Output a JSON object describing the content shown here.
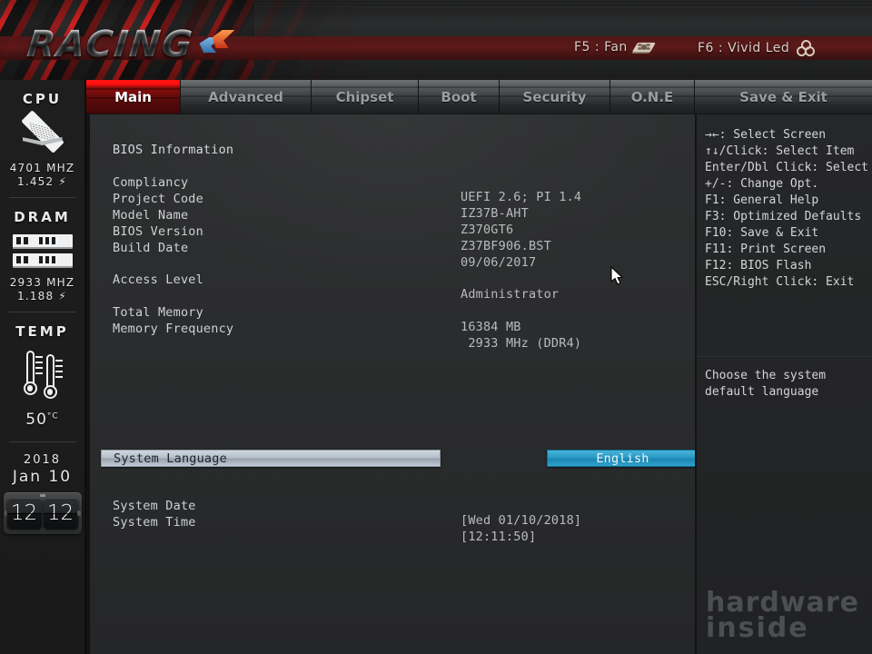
{
  "brand": {
    "logo_text": "RACING",
    "hotkeys": [
      {
        "label": "F5 : Fan",
        "icon": "fan-icon"
      },
      {
        "label": "F6 : Vivid Led",
        "icon": "rgb-led-icon"
      }
    ]
  },
  "tabs": [
    {
      "label": "Main",
      "active": true
    },
    {
      "label": "Advanced",
      "active": false
    },
    {
      "label": "Chipset",
      "active": false
    },
    {
      "label": "Boot",
      "active": false
    },
    {
      "label": "Security",
      "active": false
    },
    {
      "label": "O.N.E",
      "active": false
    },
    {
      "label": "Save & Exit",
      "active": false
    }
  ],
  "sidebar": {
    "cpu": {
      "title": "CPU",
      "icon": "cpu-chip-icon",
      "frequency": "4701 MHZ",
      "voltage": "1.452"
    },
    "dram": {
      "title": "DRAM",
      "icon": "memory-module-icon",
      "frequency": "2933 MHZ",
      "voltage": "1.188"
    },
    "temp": {
      "title": "TEMP",
      "icon": "thermometer-icon",
      "value": "50",
      "unit": "C"
    },
    "clock": {
      "year": "2018",
      "month_day": "Jan  10",
      "hours": "12",
      "minutes": "12"
    }
  },
  "main": {
    "section_title": "BIOS Information",
    "info_rows": [
      {
        "label": "Compliancy",
        "value": "UEFI 2.6; PI 1.4"
      },
      {
        "label": "Project Code",
        "value": "IZ37B-AHT"
      },
      {
        "label": "Model Name",
        "value": "Z370GT6"
      },
      {
        "label": "BIOS Version",
        "value": "Z37BF906.BST"
      },
      {
        "label": "Build Date",
        "value": "09/06/2017"
      }
    ],
    "access_level": {
      "label": "Access Level",
      "value": "Administrator"
    },
    "memory_rows": [
      {
        "label": "Total Memory",
        "value": "16384 MB"
      },
      {
        "label": "Memory Frequency",
        "value": " 2933 MHz (DDR4)"
      }
    ],
    "system_language": {
      "label": "System Language",
      "value": "English"
    },
    "datetime_rows": [
      {
        "label": "System Date",
        "value": "[Wed 01/10/2018]"
      },
      {
        "label": "System Time",
        "value": "[12:11:50]"
      }
    ]
  },
  "help": {
    "keys": "→←: Select Screen\n↑↓/Click: Select Item\nEnter/Dbl Click: Select\n+/-: Change Opt.\nF1: General Help\nF3: Optimized Defaults\nF10: Save & Exit\nF11: Print Screen\nF12: BIOS Flash\nESC/Right Click: Exit",
    "description": "Choose the system default language"
  },
  "watermark": {
    "line1": "hardware",
    "line2": "inside"
  },
  "colors": {
    "accent_red": "#ff1414",
    "highlight_blue": "#2b9bc6",
    "selection_gray": "#b7c0ca",
    "panel_bg": "#2a2b2c"
  }
}
